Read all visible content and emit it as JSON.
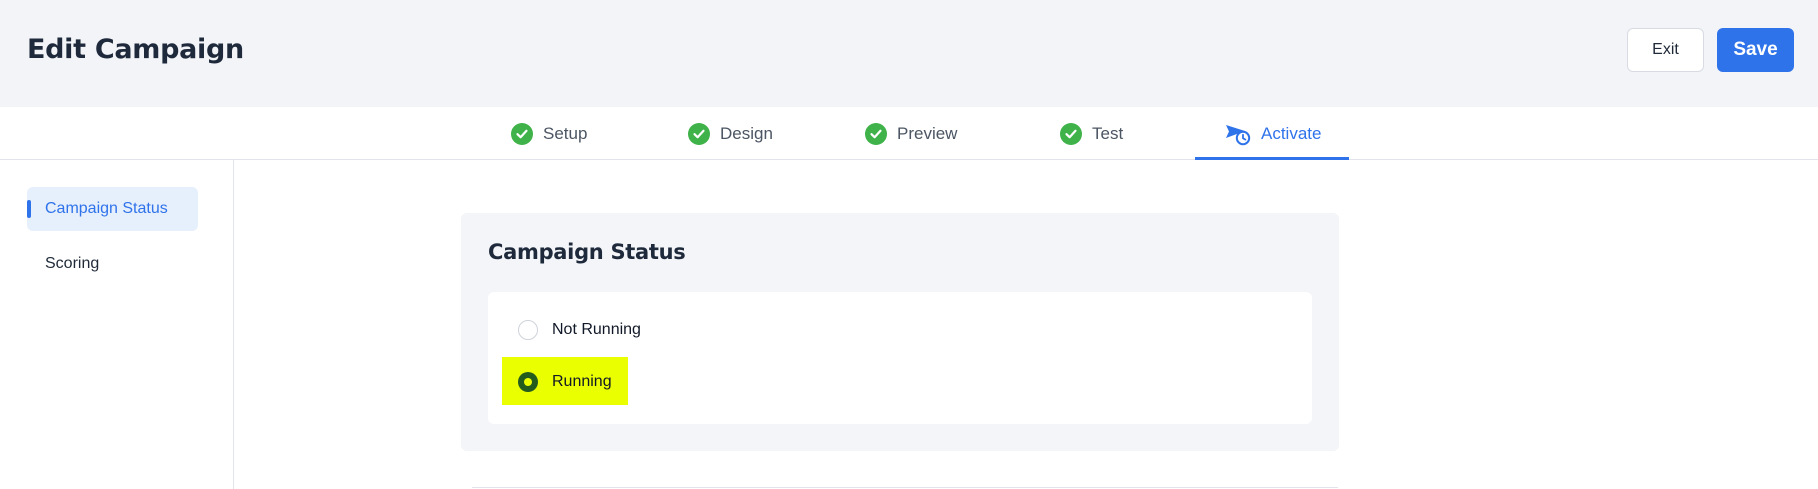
{
  "header": {
    "title": "Edit Campaign",
    "exit_label": "Exit",
    "save_label": "Save"
  },
  "steps": [
    {
      "label": "Setup",
      "state": "complete"
    },
    {
      "label": "Design",
      "state": "complete"
    },
    {
      "label": "Preview",
      "state": "complete"
    },
    {
      "label": "Test",
      "state": "complete"
    },
    {
      "label": "Activate",
      "state": "active"
    }
  ],
  "sidebar": {
    "items": [
      {
        "label": "Campaign Status",
        "active": true
      },
      {
        "label": "Scoring",
        "active": false
      }
    ]
  },
  "card": {
    "title": "Campaign Status",
    "options": [
      {
        "label": "Not Running",
        "selected": false
      },
      {
        "label": "Running",
        "selected": true
      }
    ]
  },
  "colors": {
    "accent": "#2f73ea",
    "check": "#3fb24a",
    "highlight": "#eaff00",
    "topbar_bg": "#f3f4f8"
  }
}
